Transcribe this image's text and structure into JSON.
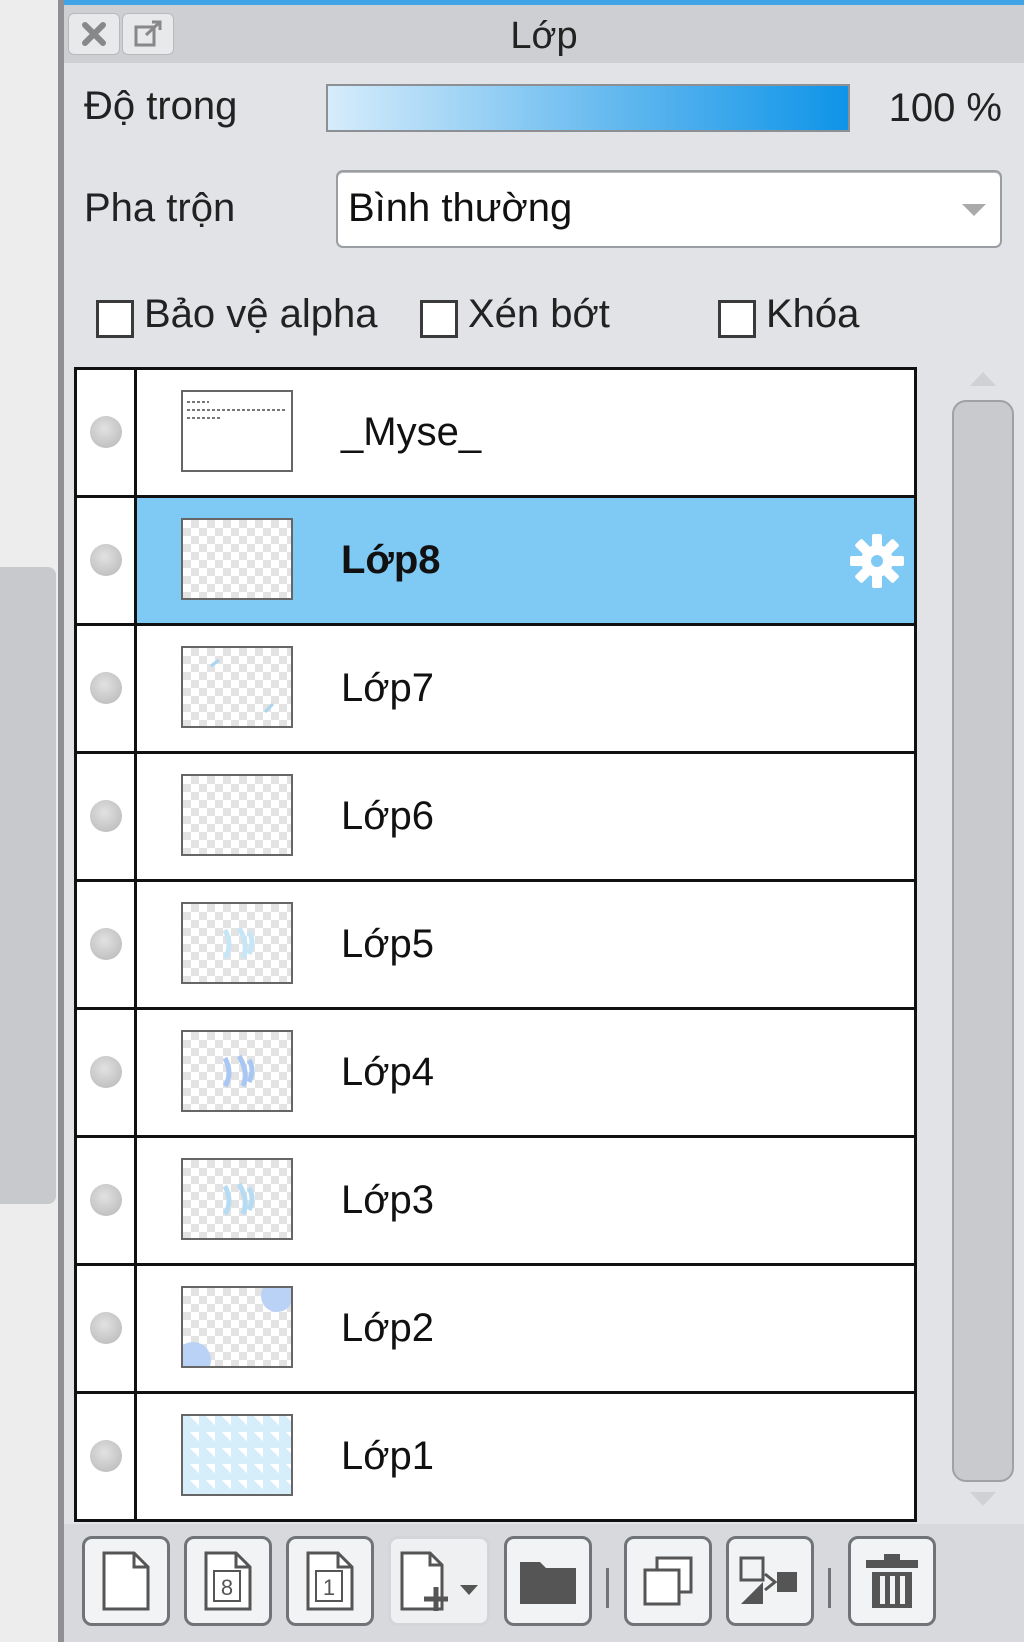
{
  "panel": {
    "title": "Lớp",
    "close_icon": "close-icon",
    "popout_icon": "popout-icon"
  },
  "opacity": {
    "label": "Độ trong",
    "value_text": "100 %",
    "value": 1.0
  },
  "blend": {
    "label": "Pha trộn",
    "selected": "Bình thường"
  },
  "checkboxes": [
    {
      "label": "Bảo vệ alpha",
      "checked": false
    },
    {
      "label": "Xén bớt",
      "checked": false
    },
    {
      "label": "Khóa",
      "checked": false
    }
  ],
  "layers": [
    {
      "name": "_Myse_",
      "selected": false
    },
    {
      "name": "Lớp8",
      "selected": true
    },
    {
      "name": "Lớp7",
      "selected": false
    },
    {
      "name": "Lớp6",
      "selected": false
    },
    {
      "name": "Lớp5",
      "selected": false
    },
    {
      "name": "Lớp4",
      "selected": false
    },
    {
      "name": "Lớp3",
      "selected": false
    },
    {
      "name": "Lớp2",
      "selected": false
    },
    {
      "name": "Lớp1",
      "selected": false
    }
  ],
  "toolbar": {
    "new_page_icon": "new-layer-icon",
    "layer8_icon": "8bit-layer-icon",
    "layer1_icon": "1bit-layer-icon",
    "new_menu_icon": "new-layer-menu-icon",
    "folder_icon": "folder-icon",
    "duplicate_icon": "duplicate-icon",
    "merge_icon": "merge-down-icon",
    "delete_icon": "trash-icon"
  },
  "colors": {
    "selected_row": "#7fcaf4",
    "accent": "#3fa5e6"
  }
}
